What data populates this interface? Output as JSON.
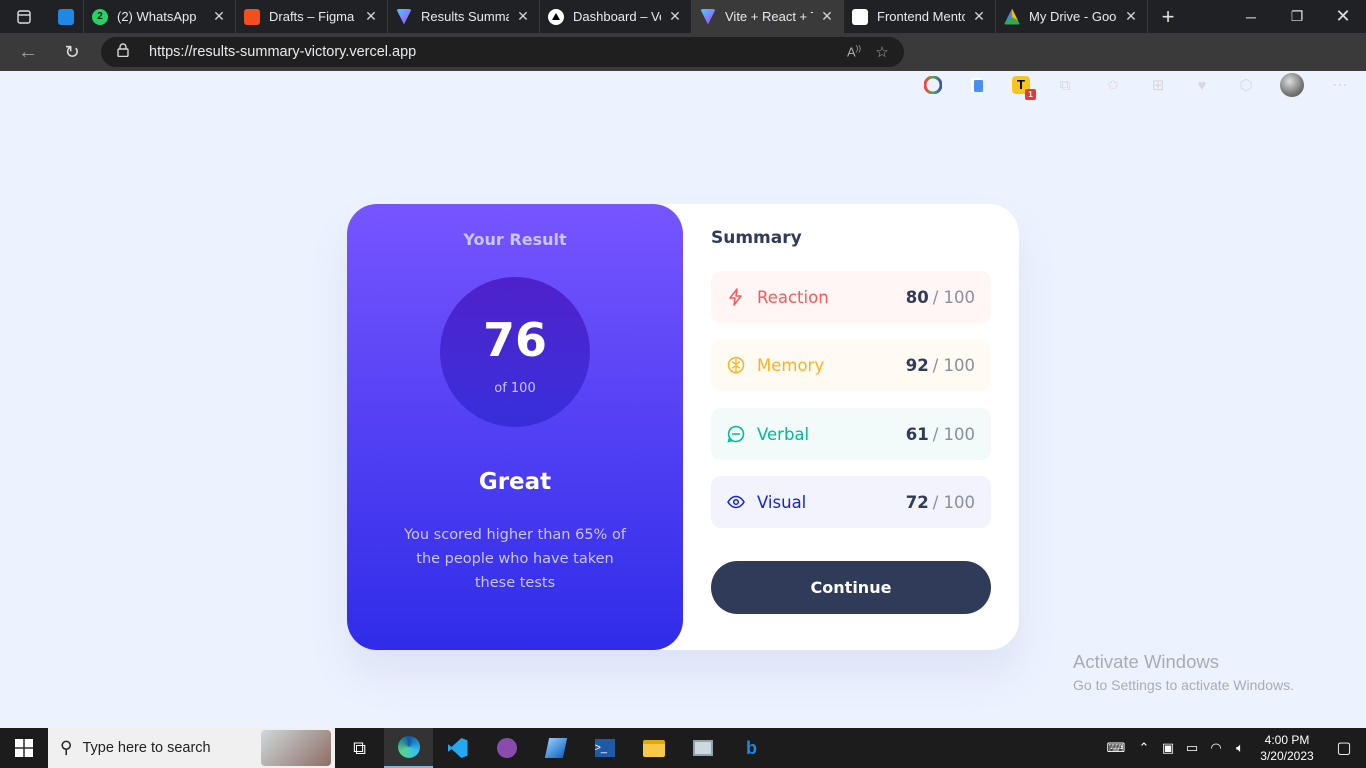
{
  "browser": {
    "tabs": [
      {
        "title": "",
        "favicon": "pinned-app-icon",
        "color": "#1e88e5"
      },
      {
        "title": "(2) WhatsApp",
        "favicon": "whatsapp-icon",
        "color": "#25d366"
      },
      {
        "title": "Drafts – Figma",
        "favicon": "figma-icon",
        "color": "#f24e1e"
      },
      {
        "title": "Results Summary",
        "favicon": "vite-icon",
        "color": "#9b5cff"
      },
      {
        "title": "Dashboard – Vercel",
        "favicon": "vercel-icon",
        "color": "#ffffff"
      },
      {
        "title": "Vite + React + TS",
        "favicon": "vite-icon",
        "color": "#9b5cff"
      },
      {
        "title": "Frontend Mentor",
        "favicon": "frontend-mentor-icon",
        "color": "#ffffff"
      },
      {
        "title": "My Drive - Google Drive",
        "favicon": "google-drive-icon",
        "color": "#fbbc04"
      }
    ],
    "active_tab_index": 5,
    "url": "https://results-summary-victory.vercel.app"
  },
  "page": {
    "result_heading": "Your Result",
    "score": "76",
    "score_of": "of 100",
    "rating": "Great",
    "description": "You scored higher than 65% of the people who have taken these tests",
    "summary_heading": "Summary",
    "categories": [
      {
        "label": "Reaction",
        "score": "80",
        "max": "/ 100",
        "icon": "lightning-icon",
        "color": "#ff5757",
        "bg": "#fff6f5"
      },
      {
        "label": "Memory",
        "score": "92",
        "max": "/ 100",
        "icon": "brain-icon",
        "color": "#ffb01f",
        "bg": "#fffbf2"
      },
      {
        "label": "Verbal",
        "score": "61",
        "max": "/ 100",
        "icon": "chat-icon",
        "color": "#00bb8f",
        "bg": "#f2fbfa"
      },
      {
        "label": "Visual",
        "score": "72",
        "max": "/ 100",
        "icon": "eye-icon",
        "color": "#1125d6",
        "bg": "#f3f3fd"
      }
    ],
    "continue_label": "Continue"
  },
  "watermark": {
    "line1": "Activate Windows",
    "line2": "Go to Settings to activate Windows."
  },
  "taskbar": {
    "search_placeholder": "Type here to search",
    "time": "4:00 PM",
    "date": "3/20/2023"
  }
}
